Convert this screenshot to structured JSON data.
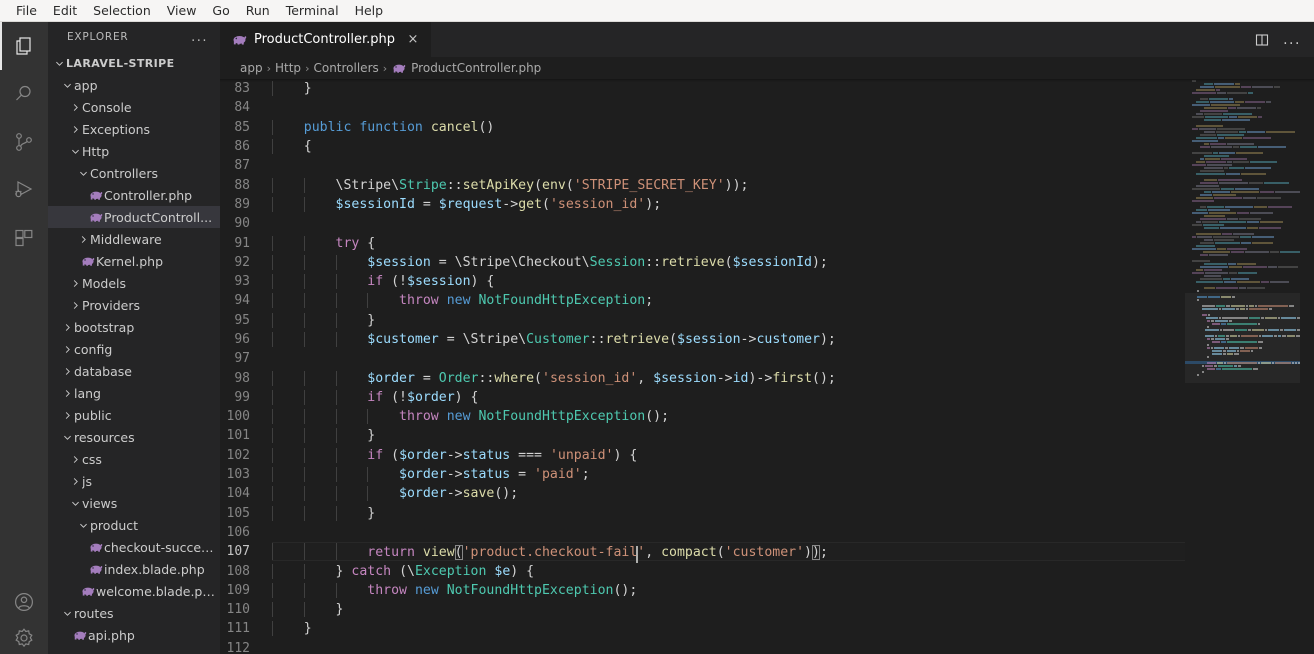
{
  "menubar": {
    "items": [
      "File",
      "Edit",
      "Selection",
      "View",
      "Go",
      "Run",
      "Terminal",
      "Help"
    ]
  },
  "activitybar": {
    "items": [
      {
        "name": "explorer",
        "label": "Explorer",
        "active": true
      },
      {
        "name": "search",
        "label": "Search",
        "active": false
      },
      {
        "name": "source-control",
        "label": "Source Control",
        "active": false
      },
      {
        "name": "run-and-debug",
        "label": "Run and Debug",
        "active": false
      },
      {
        "name": "extensions",
        "label": "Extensions",
        "active": false
      }
    ],
    "bottom": [
      {
        "name": "accounts",
        "label": "Accounts"
      },
      {
        "name": "settings",
        "label": "Manage"
      }
    ]
  },
  "sidebar": {
    "title": "EXPLORER",
    "more_label": "...",
    "tree": [
      {
        "label": "LARAVEL-STRIPE",
        "depth": 0,
        "type": "root",
        "expanded": true,
        "selected": false
      },
      {
        "label": "app",
        "depth": 1,
        "type": "folder",
        "expanded": true,
        "selected": false
      },
      {
        "label": "Console",
        "depth": 2,
        "type": "folder",
        "expanded": false,
        "selected": false
      },
      {
        "label": "Exceptions",
        "depth": 2,
        "type": "folder",
        "expanded": false,
        "selected": false
      },
      {
        "label": "Http",
        "depth": 2,
        "type": "folder",
        "expanded": true,
        "selected": false
      },
      {
        "label": "Controllers",
        "depth": 3,
        "type": "folder",
        "expanded": true,
        "selected": false
      },
      {
        "label": "Controller.php",
        "depth": 4,
        "type": "php",
        "expanded": false,
        "selected": false
      },
      {
        "label": "ProductControll...",
        "depth": 4,
        "type": "php",
        "expanded": false,
        "selected": true
      },
      {
        "label": "Middleware",
        "depth": 3,
        "type": "folder",
        "expanded": false,
        "selected": false
      },
      {
        "label": "Kernel.php",
        "depth": 3,
        "type": "php",
        "expanded": false,
        "selected": false
      },
      {
        "label": "Models",
        "depth": 2,
        "type": "folder",
        "expanded": false,
        "selected": false
      },
      {
        "label": "Providers",
        "depth": 2,
        "type": "folder",
        "expanded": false,
        "selected": false
      },
      {
        "label": "bootstrap",
        "depth": 1,
        "type": "folder",
        "expanded": false,
        "selected": false
      },
      {
        "label": "config",
        "depth": 1,
        "type": "folder",
        "expanded": false,
        "selected": false
      },
      {
        "label": "database",
        "depth": 1,
        "type": "folder",
        "expanded": false,
        "selected": false
      },
      {
        "label": "lang",
        "depth": 1,
        "type": "folder",
        "expanded": false,
        "selected": false
      },
      {
        "label": "public",
        "depth": 1,
        "type": "folder",
        "expanded": false,
        "selected": false
      },
      {
        "label": "resources",
        "depth": 1,
        "type": "folder",
        "expanded": true,
        "selected": false
      },
      {
        "label": "css",
        "depth": 2,
        "type": "folder",
        "expanded": false,
        "selected": false
      },
      {
        "label": "js",
        "depth": 2,
        "type": "folder",
        "expanded": false,
        "selected": false
      },
      {
        "label": "views",
        "depth": 2,
        "type": "folder",
        "expanded": true,
        "selected": false
      },
      {
        "label": "product",
        "depth": 3,
        "type": "folder",
        "expanded": true,
        "selected": false
      },
      {
        "label": "checkout-succes...",
        "depth": 4,
        "type": "php",
        "expanded": false,
        "selected": false
      },
      {
        "label": "index.blade.php",
        "depth": 4,
        "type": "php",
        "expanded": false,
        "selected": false
      },
      {
        "label": "welcome.blade.php",
        "depth": 3,
        "type": "php",
        "expanded": false,
        "selected": false
      },
      {
        "label": "routes",
        "depth": 1,
        "type": "folder",
        "expanded": true,
        "selected": false
      },
      {
        "label": "api.php",
        "depth": 2,
        "type": "php",
        "expanded": false,
        "selected": false
      }
    ]
  },
  "editor": {
    "tabs": [
      {
        "label": "ProductController.php",
        "icon": "php-icon",
        "active": true,
        "close_label": "×"
      }
    ],
    "actions": [
      {
        "name": "split-editor",
        "label": "Split Editor"
      },
      {
        "name": "more-actions",
        "label": "..."
      }
    ],
    "breadcrumbs": [
      "app",
      "Http",
      "Controllers",
      "ProductController.php"
    ],
    "breadcrumb_separator": "›",
    "language": "php",
    "active_line": 107,
    "first_line": 83,
    "lines": [
      {
        "n": 83,
        "indent": 1,
        "tokens": [
          {
            "t": "    ",
            "c": "pun"
          },
          {
            "t": "}",
            "c": "pun"
          }
        ]
      },
      {
        "n": 84,
        "indent": 0,
        "tokens": []
      },
      {
        "n": 85,
        "indent": 1,
        "tokens": [
          {
            "t": "    ",
            "c": "pun"
          },
          {
            "t": "public",
            "c": "kw"
          },
          {
            "t": " ",
            "c": "pun"
          },
          {
            "t": "function",
            "c": "kw"
          },
          {
            "t": " ",
            "c": "pun"
          },
          {
            "t": "cancel",
            "c": "fn"
          },
          {
            "t": "()",
            "c": "pun"
          }
        ]
      },
      {
        "n": 86,
        "indent": 1,
        "tokens": [
          {
            "t": "    ",
            "c": "pun"
          },
          {
            "t": "{",
            "c": "pun"
          }
        ]
      },
      {
        "n": 87,
        "indent": 2,
        "tokens": []
      },
      {
        "n": 88,
        "indent": 2,
        "tokens": [
          {
            "t": "        ",
            "c": "pun"
          },
          {
            "t": "\\Stripe\\",
            "c": "pun"
          },
          {
            "t": "Stripe",
            "c": "cls"
          },
          {
            "t": "::",
            "c": "pun"
          },
          {
            "t": "setApiKey",
            "c": "fn"
          },
          {
            "t": "(",
            "c": "pun"
          },
          {
            "t": "env",
            "c": "fn"
          },
          {
            "t": "(",
            "c": "pun"
          },
          {
            "t": "'STRIPE_SECRET_KEY'",
            "c": "str"
          },
          {
            "t": "));",
            "c": "pun"
          }
        ]
      },
      {
        "n": 89,
        "indent": 2,
        "tokens": [
          {
            "t": "        ",
            "c": "pun"
          },
          {
            "t": "$sessionId",
            "c": "var"
          },
          {
            "t": " = ",
            "c": "pun"
          },
          {
            "t": "$request",
            "c": "var"
          },
          {
            "t": "->",
            "c": "pun"
          },
          {
            "t": "get",
            "c": "fn"
          },
          {
            "t": "(",
            "c": "pun"
          },
          {
            "t": "'session_id'",
            "c": "str"
          },
          {
            "t": ");",
            "c": "pun"
          }
        ]
      },
      {
        "n": 90,
        "indent": 2,
        "tokens": []
      },
      {
        "n": 91,
        "indent": 2,
        "tokens": [
          {
            "t": "        ",
            "c": "pun"
          },
          {
            "t": "try",
            "c": "ctrl"
          },
          {
            "t": " {",
            "c": "pun"
          }
        ]
      },
      {
        "n": 92,
        "indent": 3,
        "tokens": [
          {
            "t": "            ",
            "c": "pun"
          },
          {
            "t": "$session",
            "c": "var"
          },
          {
            "t": " = ",
            "c": "pun"
          },
          {
            "t": "\\Stripe\\Checkout\\",
            "c": "pun"
          },
          {
            "t": "Session",
            "c": "cls"
          },
          {
            "t": "::",
            "c": "pun"
          },
          {
            "t": "retrieve",
            "c": "fn"
          },
          {
            "t": "(",
            "c": "pun"
          },
          {
            "t": "$sessionId",
            "c": "var"
          },
          {
            "t": ");",
            "c": "pun"
          }
        ]
      },
      {
        "n": 93,
        "indent": 3,
        "tokens": [
          {
            "t": "            ",
            "c": "pun"
          },
          {
            "t": "if",
            "c": "ctrl"
          },
          {
            "t": " (!",
            "c": "pun"
          },
          {
            "t": "$session",
            "c": "var"
          },
          {
            "t": ") {",
            "c": "pun"
          }
        ]
      },
      {
        "n": 94,
        "indent": 4,
        "tokens": [
          {
            "t": "                ",
            "c": "pun"
          },
          {
            "t": "throw",
            "c": "ctrl"
          },
          {
            "t": " ",
            "c": "pun"
          },
          {
            "t": "new",
            "c": "kw"
          },
          {
            "t": " ",
            "c": "pun"
          },
          {
            "t": "NotFoundHttpException",
            "c": "cls"
          },
          {
            "t": ";",
            "c": "pun"
          }
        ]
      },
      {
        "n": 95,
        "indent": 3,
        "tokens": [
          {
            "t": "            ",
            "c": "pun"
          },
          {
            "t": "}",
            "c": "pun"
          }
        ]
      },
      {
        "n": 96,
        "indent": 3,
        "tokens": [
          {
            "t": "            ",
            "c": "pun"
          },
          {
            "t": "$customer",
            "c": "var"
          },
          {
            "t": " = ",
            "c": "pun"
          },
          {
            "t": "\\Stripe\\",
            "c": "pun"
          },
          {
            "t": "Customer",
            "c": "cls"
          },
          {
            "t": "::",
            "c": "pun"
          },
          {
            "t": "retrieve",
            "c": "fn"
          },
          {
            "t": "(",
            "c": "pun"
          },
          {
            "t": "$session",
            "c": "var"
          },
          {
            "t": "->",
            "c": "pun"
          },
          {
            "t": "customer",
            "c": "var"
          },
          {
            "t": ");",
            "c": "pun"
          }
        ]
      },
      {
        "n": 97,
        "indent": 3,
        "tokens": []
      },
      {
        "n": 98,
        "indent": 3,
        "tokens": [
          {
            "t": "            ",
            "c": "pun"
          },
          {
            "t": "$order",
            "c": "var"
          },
          {
            "t": " = ",
            "c": "pun"
          },
          {
            "t": "Order",
            "c": "cls"
          },
          {
            "t": "::",
            "c": "pun"
          },
          {
            "t": "where",
            "c": "fn"
          },
          {
            "t": "(",
            "c": "pun"
          },
          {
            "t": "'session_id'",
            "c": "str"
          },
          {
            "t": ", ",
            "c": "pun"
          },
          {
            "t": "$session",
            "c": "var"
          },
          {
            "t": "->",
            "c": "pun"
          },
          {
            "t": "id",
            "c": "var"
          },
          {
            "t": ")->",
            "c": "pun"
          },
          {
            "t": "first",
            "c": "fn"
          },
          {
            "t": "();",
            "c": "pun"
          }
        ]
      },
      {
        "n": 99,
        "indent": 3,
        "tokens": [
          {
            "t": "            ",
            "c": "pun"
          },
          {
            "t": "if",
            "c": "ctrl"
          },
          {
            "t": " (!",
            "c": "pun"
          },
          {
            "t": "$order",
            "c": "var"
          },
          {
            "t": ") {",
            "c": "pun"
          }
        ]
      },
      {
        "n": 100,
        "indent": 4,
        "tokens": [
          {
            "t": "                ",
            "c": "pun"
          },
          {
            "t": "throw",
            "c": "ctrl"
          },
          {
            "t": " ",
            "c": "pun"
          },
          {
            "t": "new",
            "c": "kw"
          },
          {
            "t": " ",
            "c": "pun"
          },
          {
            "t": "NotFoundHttpException",
            "c": "cls"
          },
          {
            "t": "();",
            "c": "pun"
          }
        ]
      },
      {
        "n": 101,
        "indent": 3,
        "tokens": [
          {
            "t": "            ",
            "c": "pun"
          },
          {
            "t": "}",
            "c": "pun"
          }
        ]
      },
      {
        "n": 102,
        "indent": 3,
        "tokens": [
          {
            "t": "            ",
            "c": "pun"
          },
          {
            "t": "if",
            "c": "ctrl"
          },
          {
            "t": " (",
            "c": "pun"
          },
          {
            "t": "$order",
            "c": "var"
          },
          {
            "t": "->",
            "c": "pun"
          },
          {
            "t": "status",
            "c": "var"
          },
          {
            "t": " === ",
            "c": "pun"
          },
          {
            "t": "'unpaid'",
            "c": "str"
          },
          {
            "t": ") {",
            "c": "pun"
          }
        ]
      },
      {
        "n": 103,
        "indent": 4,
        "tokens": [
          {
            "t": "                ",
            "c": "pun"
          },
          {
            "t": "$order",
            "c": "var"
          },
          {
            "t": "->",
            "c": "pun"
          },
          {
            "t": "status",
            "c": "var"
          },
          {
            "t": " = ",
            "c": "pun"
          },
          {
            "t": "'paid'",
            "c": "str"
          },
          {
            "t": ";",
            "c": "pun"
          }
        ]
      },
      {
        "n": 104,
        "indent": 4,
        "tokens": [
          {
            "t": "                ",
            "c": "pun"
          },
          {
            "t": "$order",
            "c": "var"
          },
          {
            "t": "->",
            "c": "pun"
          },
          {
            "t": "save",
            "c": "fn"
          },
          {
            "t": "();",
            "c": "pun"
          }
        ]
      },
      {
        "n": 105,
        "indent": 3,
        "tokens": [
          {
            "t": "            ",
            "c": "pun"
          },
          {
            "t": "}",
            "c": "pun"
          }
        ]
      },
      {
        "n": 106,
        "indent": 3,
        "tokens": []
      },
      {
        "n": 107,
        "indent": 3,
        "tokens": [
          {
            "t": "            ",
            "c": "pun"
          },
          {
            "t": "return",
            "c": "ctrl"
          },
          {
            "t": " ",
            "c": "pun"
          },
          {
            "t": "view",
            "c": "fn"
          },
          {
            "t": "(",
            "c": "match"
          },
          {
            "t": "'product.checkout-fail'",
            "c": "str",
            "cursor_after_index": 22
          },
          {
            "t": ", ",
            "c": "pun"
          },
          {
            "t": "compact",
            "c": "fn"
          },
          {
            "t": "(",
            "c": "pun"
          },
          {
            "t": "'customer'",
            "c": "str"
          },
          {
            "t": ")",
            "c": "pun"
          },
          {
            "t": ")",
            "c": "match"
          },
          {
            "t": ";",
            "c": "pun"
          }
        ]
      },
      {
        "n": 108,
        "indent": 2,
        "tokens": [
          {
            "t": "        ",
            "c": "pun"
          },
          {
            "t": "} ",
            "c": "pun"
          },
          {
            "t": "catch",
            "c": "ctrl"
          },
          {
            "t": " (\\",
            "c": "pun"
          },
          {
            "t": "Exception",
            "c": "cls"
          },
          {
            "t": " ",
            "c": "pun"
          },
          {
            "t": "$e",
            "c": "var"
          },
          {
            "t": ") {",
            "c": "pun"
          }
        ]
      },
      {
        "n": 109,
        "indent": 3,
        "tokens": [
          {
            "t": "            ",
            "c": "pun"
          },
          {
            "t": "throw",
            "c": "ctrl"
          },
          {
            "t": " ",
            "c": "pun"
          },
          {
            "t": "new",
            "c": "kw"
          },
          {
            "t": " ",
            "c": "pun"
          },
          {
            "t": "NotFoundHttpException",
            "c": "cls"
          },
          {
            "t": "();",
            "c": "pun"
          }
        ]
      },
      {
        "n": 110,
        "indent": 2,
        "tokens": [
          {
            "t": "        ",
            "c": "pun"
          },
          {
            "t": "}",
            "c": "pun"
          }
        ]
      },
      {
        "n": 111,
        "indent": 1,
        "tokens": [
          {
            "t": "    ",
            "c": "pun"
          },
          {
            "t": "}",
            "c": "pun"
          }
        ]
      },
      {
        "n": 112,
        "indent": 0,
        "tokens": []
      }
    ]
  },
  "colors": {
    "editor_bg": "#1e1e1e",
    "sidebar_bg": "#252526",
    "activitybar_bg": "#333333",
    "menubar_bg": "#f6f5f4",
    "keyword": "#569cd6",
    "control": "#c586c0",
    "function": "#dcdcaa",
    "variable": "#9cdcfe",
    "class": "#4ec9b0",
    "string": "#ce9178",
    "text": "#d4d4d4",
    "linenumber": "#858585",
    "linenumber_active": "#c6c6c6",
    "selection_bg": "#37373d",
    "php_icon": "#a47dbd"
  }
}
